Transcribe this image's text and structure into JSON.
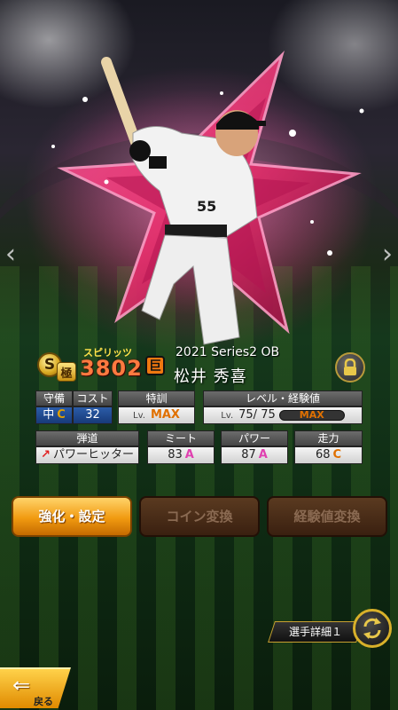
{
  "header": {
    "rarity_letter": "S",
    "grade_kanji": "極",
    "spirits_label": "スピリッツ",
    "spirits_value": "3802",
    "team_logo": "巨",
    "series": "2021 Series2 OB",
    "player_name": "松井 秀喜",
    "lock_icon": "lock-icon"
  },
  "stats": {
    "position_label": "守備",
    "position_value": "中",
    "position_grade": "C",
    "cost_label": "コスト",
    "cost_value": "32",
    "training_label": "特訓",
    "training_lv": "Lv.",
    "training_value": "MAX",
    "level_label": "レベル・経験値",
    "level_lv": "Lv.",
    "level_value": "75/ 75",
    "exp_value": "MAX",
    "trajectory_label": "弾道",
    "trajectory_value": "パワーヒッター",
    "meet_label": "ミート",
    "meet_value": "83",
    "meet_grade": "A",
    "power_label": "パワー",
    "power_value": "87",
    "power_grade": "A",
    "speed_label": "走力",
    "speed_value": "68",
    "speed_grade": "C"
  },
  "buttons": {
    "enhance": "強化・設定",
    "coin_convert": "コイン変換",
    "exp_convert": "経験値変換",
    "player_detail": "選手詳細１",
    "back": "戻る"
  },
  "player": {
    "uniform_number": "55"
  },
  "colors": {
    "accent_orange": "#f19a10",
    "grade_a": "#e040b0",
    "grade_c": "#e0a000",
    "star_pink": "#e8306e"
  }
}
